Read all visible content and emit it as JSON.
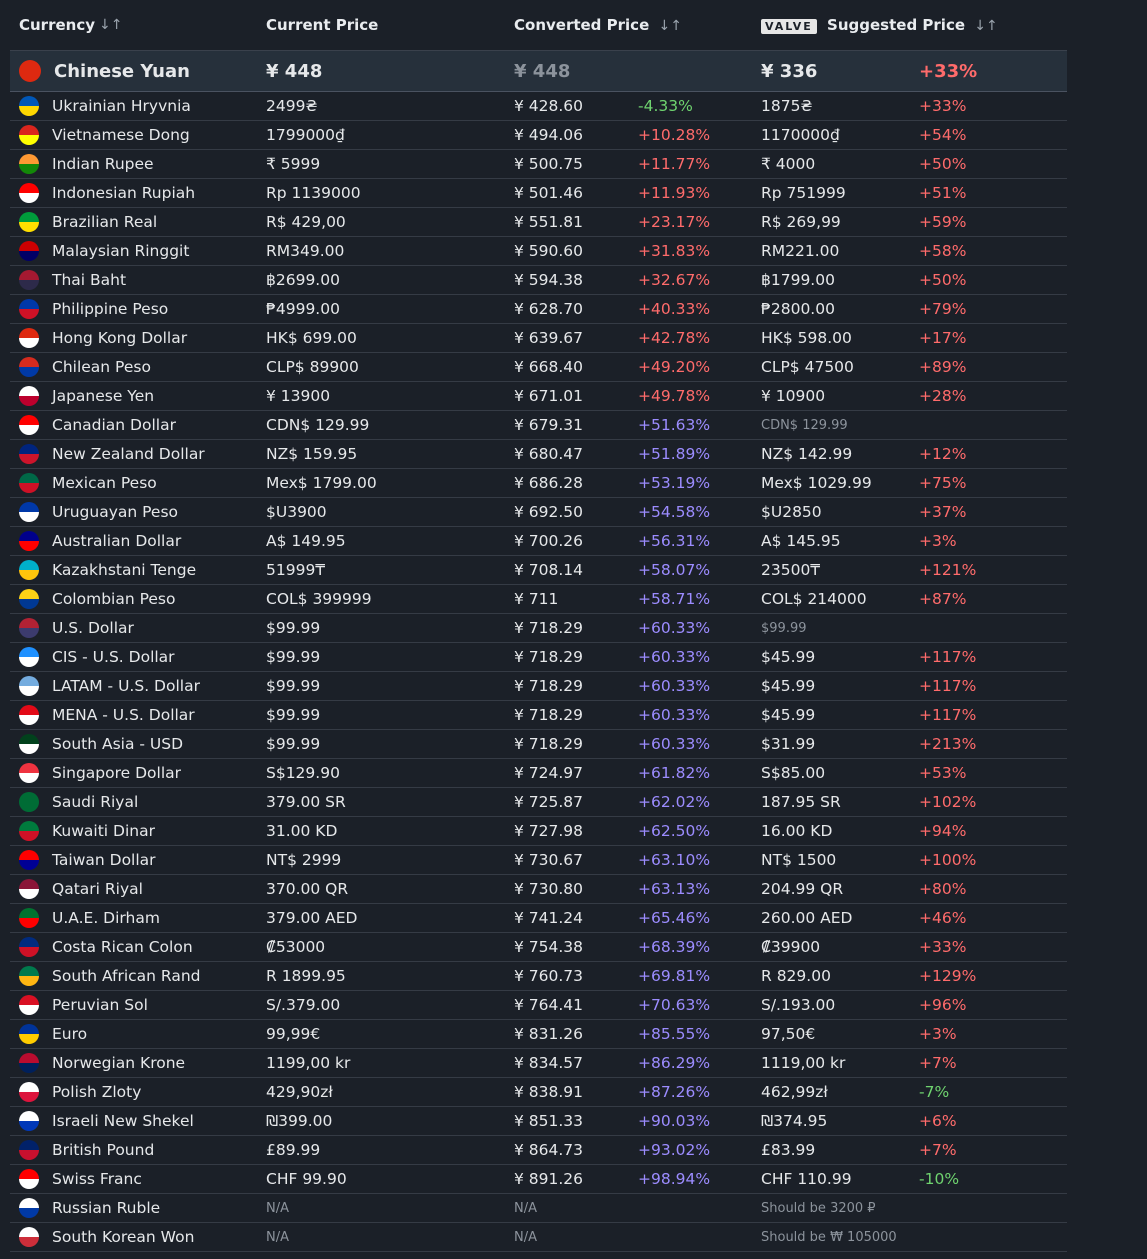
{
  "headers": {
    "currency": "Currency",
    "current_price": "Current Price",
    "converted_price": "Converted Price",
    "valve_badge": "VALVE",
    "suggested_price": "Suggested Price",
    "sort_glyph": "↓↑"
  },
  "top_row": {
    "name": "Chinese Yuan",
    "current": "¥ 448",
    "converted": "¥ 448",
    "diff": "",
    "suggested": "¥ 336",
    "sdiff": "+33%",
    "flag_color": "#de2910"
  },
  "rows": [
    {
      "name": "Ukrainian Hryvnia",
      "current": "2499₴",
      "converted": "¥ 428.60",
      "diff": "-4.33%",
      "suggested": "1875₴",
      "sdiff": "+33%",
      "flag_color": "#0057b7",
      "flag_color2": "#ffd700"
    },
    {
      "name": "Vietnamese Dong",
      "current": "1799000₫",
      "converted": "¥ 494.06",
      "diff": "+10.28%",
      "suggested": "1170000₫",
      "sdiff": "+54%",
      "flag_color": "#da251d",
      "flag_color2": "#ffff00"
    },
    {
      "name": "Indian Rupee",
      "current": "₹ 5999",
      "converted": "¥ 500.75",
      "diff": "+11.77%",
      "suggested": "₹ 4000",
      "sdiff": "+50%",
      "flag_color": "#ff9933",
      "flag_color2": "#138808"
    },
    {
      "name": "Indonesian Rupiah",
      "current": "Rp 1139000",
      "converted": "¥ 501.46",
      "diff": "+11.93%",
      "suggested": "Rp 751999",
      "sdiff": "+51%",
      "flag_color": "#ff0000",
      "flag_color2": "#ffffff"
    },
    {
      "name": "Brazilian Real",
      "current": "R$ 429,00",
      "converted": "¥ 551.81",
      "diff": "+23.17%",
      "suggested": "R$ 269,99",
      "sdiff": "+59%",
      "flag_color": "#009c3b",
      "flag_color2": "#ffdf00"
    },
    {
      "name": "Malaysian Ringgit",
      "current": "RM349.00",
      "converted": "¥ 590.60",
      "diff": "+31.83%",
      "suggested": "RM221.00",
      "sdiff": "+58%",
      "flag_color": "#cc0001",
      "flag_color2": "#010066"
    },
    {
      "name": "Thai Baht",
      "current": "฿2699.00",
      "converted": "¥ 594.38",
      "diff": "+32.67%",
      "suggested": "฿1799.00",
      "sdiff": "+50%",
      "flag_color": "#a51931",
      "flag_color2": "#2d2a4a"
    },
    {
      "name": "Philippine Peso",
      "current": "₱4999.00",
      "converted": "¥ 628.70",
      "diff": "+40.33%",
      "suggested": "₱2800.00",
      "sdiff": "+79%",
      "flag_color": "#0038a8",
      "flag_color2": "#ce1126"
    },
    {
      "name": "Hong Kong Dollar",
      "current": "HK$ 699.00",
      "converted": "¥ 639.67",
      "diff": "+42.78%",
      "suggested": "HK$ 598.00",
      "sdiff": "+17%",
      "flag_color": "#de2910",
      "flag_color2": "#ffffff"
    },
    {
      "name": "Chilean Peso",
      "current": "CLP$ 89900",
      "converted": "¥ 668.40",
      "diff": "+49.20%",
      "suggested": "CLP$ 47500",
      "sdiff": "+89%",
      "flag_color": "#d52b1e",
      "flag_color2": "#0039a6"
    },
    {
      "name": "Japanese Yen",
      "current": "¥ 13900",
      "converted": "¥ 671.01",
      "diff": "+49.78%",
      "suggested": "¥ 10900",
      "sdiff": "+28%",
      "flag_color": "#ffffff",
      "flag_color2": "#bc002d"
    },
    {
      "name": "Canadian Dollar",
      "current": "CDN$ 129.99",
      "converted": "¥ 679.31",
      "diff": "+51.63%",
      "suggested": "CDN$ 129.99",
      "sdiff": "",
      "suggested_muted": true,
      "flag_color": "#ff0000",
      "flag_color2": "#ffffff"
    },
    {
      "name": "New Zealand Dollar",
      "current": "NZ$ 159.95",
      "converted": "¥ 680.47",
      "diff": "+51.89%",
      "suggested": "NZ$ 142.99",
      "sdiff": "+12%",
      "flag_color": "#00247d",
      "flag_color2": "#cc142b"
    },
    {
      "name": "Mexican Peso",
      "current": "Mex$ 1799.00",
      "converted": "¥ 686.28",
      "diff": "+53.19%",
      "suggested": "Mex$ 1029.99",
      "sdiff": "+75%",
      "flag_color": "#006847",
      "flag_color2": "#ce1126"
    },
    {
      "name": "Uruguayan Peso",
      "current": "$U3900",
      "converted": "¥ 692.50",
      "diff": "+54.58%",
      "suggested": "$U2850",
      "sdiff": "+37%",
      "flag_color": "#0038a8",
      "flag_color2": "#ffffff"
    },
    {
      "name": "Australian Dollar",
      "current": "A$ 149.95",
      "converted": "¥ 700.26",
      "diff": "+56.31%",
      "suggested": "A$ 145.95",
      "sdiff": "+3%",
      "flag_color": "#00008b",
      "flag_color2": "#ff0000"
    },
    {
      "name": "Kazakhstani Tenge",
      "current": "51999₸",
      "converted": "¥ 708.14",
      "diff": "+58.07%",
      "suggested": "23500₸",
      "sdiff": "+121%",
      "flag_color": "#00afca",
      "flag_color2": "#fec50c"
    },
    {
      "name": "Colombian Peso",
      "current": "COL$ 399999",
      "converted": "¥ 711",
      "diff": "+58.71%",
      "suggested": "COL$ 214000",
      "sdiff": "+87%",
      "flag_color": "#fcd116",
      "flag_color2": "#003893"
    },
    {
      "name": "U.S. Dollar",
      "current": "$99.99",
      "converted": "¥ 718.29",
      "diff": "+60.33%",
      "suggested": "$99.99",
      "sdiff": "",
      "suggested_muted": true,
      "flag_color": "#b22234",
      "flag_color2": "#3c3b6e"
    },
    {
      "name": "CIS - U.S. Dollar",
      "current": "$99.99",
      "converted": "¥ 718.29",
      "diff": "+60.33%",
      "suggested": "$45.99",
      "sdiff": "+117%",
      "flag_color": "#1e90ff",
      "flag_color2": "#ffffff"
    },
    {
      "name": "LATAM - U.S. Dollar",
      "current": "$99.99",
      "converted": "¥ 718.29",
      "diff": "+60.33%",
      "suggested": "$45.99",
      "sdiff": "+117%",
      "flag_color": "#74acdf",
      "flag_color2": "#ffffff"
    },
    {
      "name": "MENA - U.S. Dollar",
      "current": "$99.99",
      "converted": "¥ 718.29",
      "diff": "+60.33%",
      "suggested": "$45.99",
      "sdiff": "+117%",
      "flag_color": "#e30a17",
      "flag_color2": "#ffffff"
    },
    {
      "name": "South Asia - USD",
      "current": "$99.99",
      "converted": "¥ 718.29",
      "diff": "+60.33%",
      "suggested": "$31.99",
      "sdiff": "+213%",
      "flag_color": "#01411c",
      "flag_color2": "#ffffff"
    },
    {
      "name": "Singapore Dollar",
      "current": "S$129.90",
      "converted": "¥ 724.97",
      "diff": "+61.82%",
      "suggested": "S$85.00",
      "sdiff": "+53%",
      "flag_color": "#ef3340",
      "flag_color2": "#ffffff"
    },
    {
      "name": "Saudi Riyal",
      "current": "379.00 SR",
      "converted": "¥ 725.87",
      "diff": "+62.02%",
      "suggested": "187.95 SR",
      "sdiff": "+102%",
      "flag_color": "#006c35",
      "flag_color2": "#006c35"
    },
    {
      "name": "Kuwaiti Dinar",
      "current": "31.00 KD",
      "converted": "¥ 727.98",
      "diff": "+62.50%",
      "suggested": "16.00 KD",
      "sdiff": "+94%",
      "flag_color": "#007a3d",
      "flag_color2": "#ce1126"
    },
    {
      "name": "Taiwan Dollar",
      "current": "NT$ 2999",
      "converted": "¥ 730.67",
      "diff": "+63.10%",
      "suggested": "NT$ 1500",
      "sdiff": "+100%",
      "flag_color": "#fe0000",
      "flag_color2": "#000095"
    },
    {
      "name": "Qatari Riyal",
      "current": "370.00 QR",
      "converted": "¥ 730.80",
      "diff": "+63.13%",
      "suggested": "204.99 QR",
      "sdiff": "+80%",
      "flag_color": "#8a1538",
      "flag_color2": "#ffffff"
    },
    {
      "name": "U.A.E. Dirham",
      "current": "379.00 AED",
      "converted": "¥ 741.24",
      "diff": "+65.46%",
      "suggested": "260.00 AED",
      "sdiff": "+46%",
      "flag_color": "#00732f",
      "flag_color2": "#ff0000"
    },
    {
      "name": "Costa Rican Colon",
      "current": "₡53000",
      "converted": "¥ 754.38",
      "diff": "+68.39%",
      "suggested": "₡39900",
      "sdiff": "+33%",
      "flag_color": "#002b7f",
      "flag_color2": "#ce1126"
    },
    {
      "name": "South African Rand",
      "current": "R 1899.95",
      "converted": "¥ 760.73",
      "diff": "+69.81%",
      "suggested": "R 829.00",
      "sdiff": "+129%",
      "flag_color": "#007a4d",
      "flag_color2": "#ffb612"
    },
    {
      "name": "Peruvian Sol",
      "current": "S/.379.00",
      "converted": "¥ 764.41",
      "diff": "+70.63%",
      "suggested": "S/.193.00",
      "sdiff": "+96%",
      "flag_color": "#d91023",
      "flag_color2": "#ffffff"
    },
    {
      "name": "Euro",
      "current": "99,99€",
      "converted": "¥ 831.26",
      "diff": "+85.55%",
      "suggested": "97,50€",
      "sdiff": "+3%",
      "flag_color": "#003399",
      "flag_color2": "#ffcc00"
    },
    {
      "name": "Norwegian Krone",
      "current": "1199,00 kr",
      "converted": "¥ 834.57",
      "diff": "+86.29%",
      "suggested": "1119,00 kr",
      "sdiff": "+7%",
      "flag_color": "#ba0c2f",
      "flag_color2": "#00205b"
    },
    {
      "name": "Polish Zloty",
      "current": "429,90zł",
      "converted": "¥ 838.91",
      "diff": "+87.26%",
      "suggested": "462,99zł",
      "sdiff": "-7%",
      "flag_color": "#ffffff",
      "flag_color2": "#dc143c"
    },
    {
      "name": "Israeli New Shekel",
      "current": "₪399.00",
      "converted": "¥ 851.33",
      "diff": "+90.03%",
      "suggested": "₪374.95",
      "sdiff": "+6%",
      "flag_color": "#ffffff",
      "flag_color2": "#0038b8"
    },
    {
      "name": "British Pound",
      "current": "£89.99",
      "converted": "¥ 864.73",
      "diff": "+93.02%",
      "suggested": "£83.99",
      "sdiff": "+7%",
      "flag_color": "#012169",
      "flag_color2": "#c8102e"
    },
    {
      "name": "Swiss Franc",
      "current": "CHF 99.90",
      "converted": "¥ 891.26",
      "diff": "+98.94%",
      "suggested": "CHF 110.99",
      "sdiff": "-10%",
      "flag_color": "#ff0000",
      "flag_color2": "#ffffff"
    },
    {
      "name": "Russian Ruble",
      "current": "N/A",
      "converted": "N/A",
      "diff": "",
      "suggested": "Should be 3200 ₽",
      "sdiff": "",
      "na": true,
      "flag_color": "#ffffff",
      "flag_color2": "#0039a6"
    },
    {
      "name": "South Korean Won",
      "current": "N/A",
      "converted": "N/A",
      "diff": "",
      "suggested": "Should be ₩ 105000",
      "sdiff": "",
      "na": true,
      "flag_color": "#ffffff",
      "flag_color2": "#cd2e3a"
    }
  ],
  "colors": {
    "positive_conv": "#9c8cff",
    "negative": "#6fd36f",
    "warning": "#ff6b6b",
    "muted": "#8c939c"
  }
}
